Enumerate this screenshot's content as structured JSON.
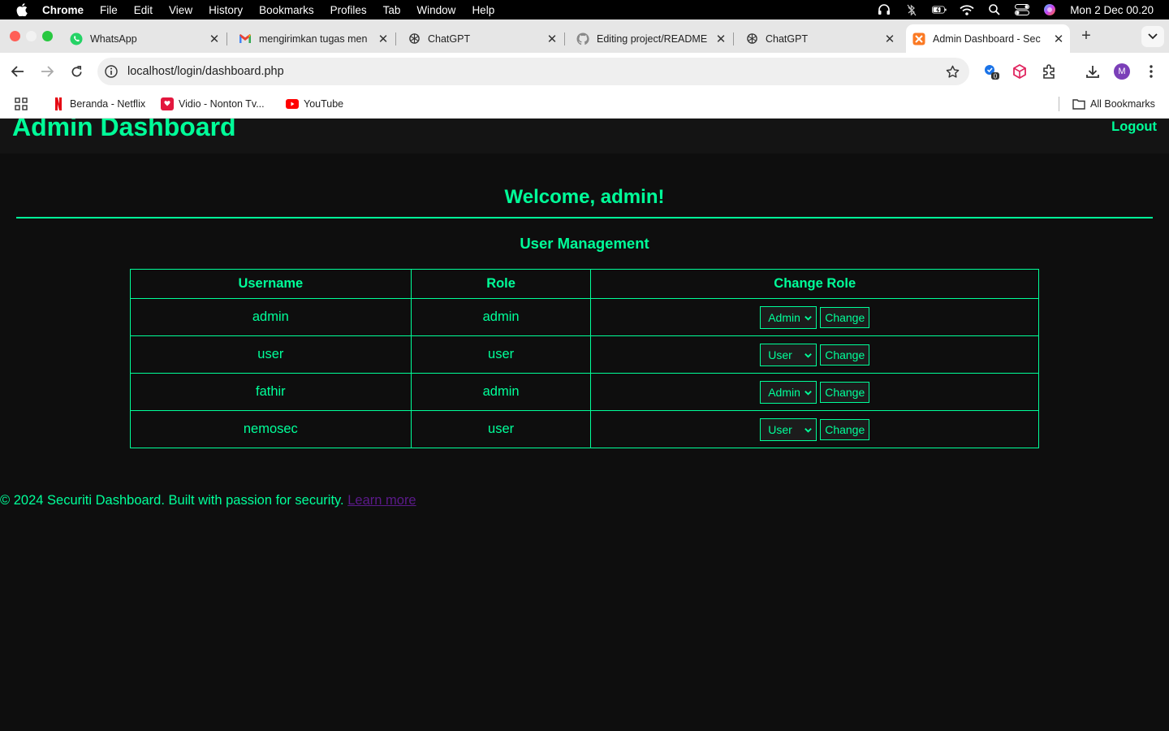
{
  "menubar": {
    "app": "Chrome",
    "items": [
      "File",
      "Edit",
      "View",
      "History",
      "Bookmarks",
      "Profiles",
      "Tab",
      "Window",
      "Help"
    ],
    "clock": "Mon 2 Dec  00.20"
  },
  "tabs": [
    {
      "title": "WhatsApp",
      "icon": "whatsapp-icon"
    },
    {
      "title": "mengirimkan tugas men",
      "icon": "gmail-icon"
    },
    {
      "title": "ChatGPT",
      "icon": "chatgpt-icon"
    },
    {
      "title": "Editing project/README",
      "icon": "github-icon"
    },
    {
      "title": "ChatGPT",
      "icon": "chatgpt-icon"
    },
    {
      "title": "Admin Dashboard - Sec",
      "icon": "xampp-icon",
      "active": true
    }
  ],
  "toolbar": {
    "url": "localhost/login/dashboard.php",
    "extension_badge": "0",
    "avatar_letter": "M"
  },
  "bookmarks": {
    "items": [
      {
        "label": "Beranda - Netflix",
        "icon": "netflix-icon"
      },
      {
        "label": "Vidio - Nonton Tv...",
        "icon": "vidio-icon"
      },
      {
        "label": "YouTube",
        "icon": "youtube-icon"
      }
    ],
    "all_bookmarks": "All Bookmarks"
  },
  "page": {
    "title": "Admin Dashboard",
    "logout": "Logout",
    "welcome": "Welcome, admin!",
    "section_title": "User Management",
    "columns": [
      "Username",
      "Role",
      "Change Role"
    ],
    "rows": [
      {
        "username": "admin",
        "role": "admin",
        "selected": "Admin",
        "button": "Change"
      },
      {
        "username": "user",
        "role": "user",
        "selected": "User",
        "button": "Change"
      },
      {
        "username": "fathir",
        "role": "admin",
        "selected": "Admin",
        "button": "Change"
      },
      {
        "username": "nemosec",
        "role": "user",
        "selected": "User",
        "button": "Change"
      }
    ],
    "footer_text": "© 2024 Securiti Dashboard. Built with passion for security.",
    "footer_link": "Learn more"
  },
  "colors": {
    "accent": "#00ff99",
    "background": "#0e0e0e",
    "header_bg": "#141414",
    "link_visited": "#5b1a8a"
  }
}
